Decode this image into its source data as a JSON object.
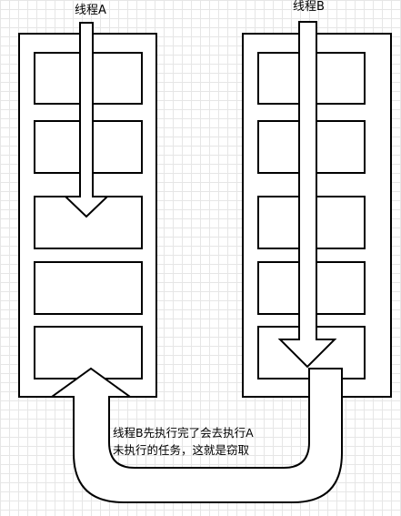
{
  "diagram": {
    "nodes": [
      {
        "id": "thread-a",
        "label": "线程A",
        "task_count": 5
      },
      {
        "id": "thread-b",
        "label": "线程B",
        "task_count": 5
      }
    ],
    "edges": [
      {
        "from": "thread-b",
        "to": "thread-a",
        "meaning": "work stealing path"
      }
    ],
    "note_lines": [
      "线程B先执行完了会去执行A",
      "未执行的任务，这就是窃取"
    ]
  },
  "colors": {
    "stroke": "#000000",
    "fill": "#ffffff",
    "grid": "#e6e6e6"
  }
}
